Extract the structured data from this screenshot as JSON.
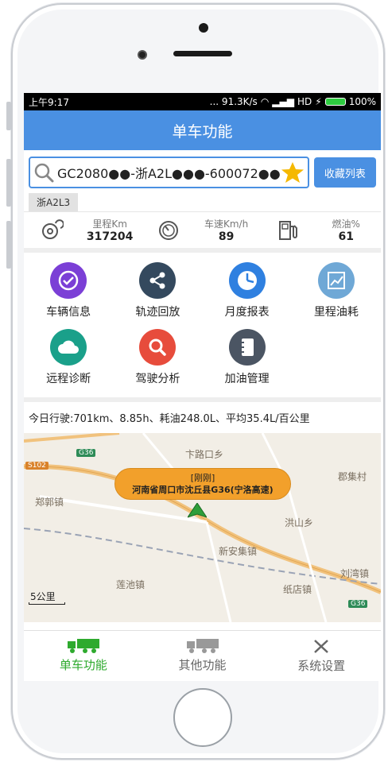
{
  "status_bar": {
    "time": "上午9:17",
    "network": "... 91.3K/s",
    "signal": "HD",
    "battery": "100%"
  },
  "header": {
    "title": "单车功能"
  },
  "search": {
    "value": "GC2080●●-浙A2L●●●-600072●●",
    "favorites_label": "收藏列表"
  },
  "vehicle_tag": "浙A2L3",
  "stats": [
    {
      "label": "里程Km",
      "value": "317204",
      "icon": "odometer-icon"
    },
    {
      "label": "车速Km/h",
      "value": "89",
      "icon": "speedometer-icon"
    },
    {
      "label": "燃油%",
      "value": "61",
      "icon": "fuel-pump-icon"
    }
  ],
  "functions": [
    {
      "label": "车辆信息",
      "icon": "check-circle-icon",
      "color": "#7b3fd6"
    },
    {
      "label": "轨迹回放",
      "icon": "share-icon",
      "color": "#34495e"
    },
    {
      "label": "月度报表",
      "icon": "clock-icon",
      "color": "#2f80e0"
    },
    {
      "label": "里程油耗",
      "icon": "line-chart-icon",
      "color": "#6fa8d6"
    },
    {
      "label": "远程诊断",
      "icon": "cloud-icon",
      "color": "#1aa08a"
    },
    {
      "label": "驾驶分析",
      "icon": "magnifier-icon",
      "color": "#e74c3c"
    },
    {
      "label": "加油管理",
      "icon": "notebook-icon",
      "color": "#4b5563"
    }
  ],
  "today_summary": "今日行驶:701km、8.85h、耗油248.0L、平均35.4L/百公里",
  "map": {
    "bubble_line1": "[刚刚]",
    "bubble_line2": "河南省周口市沈丘县G36(宁洛高速)",
    "places": [
      "卞路口乡",
      "郡集村",
      "郑郭镇",
      "洪山乡",
      "新安集镇",
      "刘湾镇",
      "莲池镇",
      "纸店镇"
    ],
    "roads": [
      "G36",
      "S102",
      "G36"
    ],
    "scale": "5公里"
  },
  "tabs": [
    {
      "label": "单车功能",
      "active": true,
      "color": "#2eaa2e"
    },
    {
      "label": "其他功能",
      "active": false,
      "color": "#666666"
    },
    {
      "label": "系统设置",
      "active": false,
      "color": "#666666"
    }
  ]
}
